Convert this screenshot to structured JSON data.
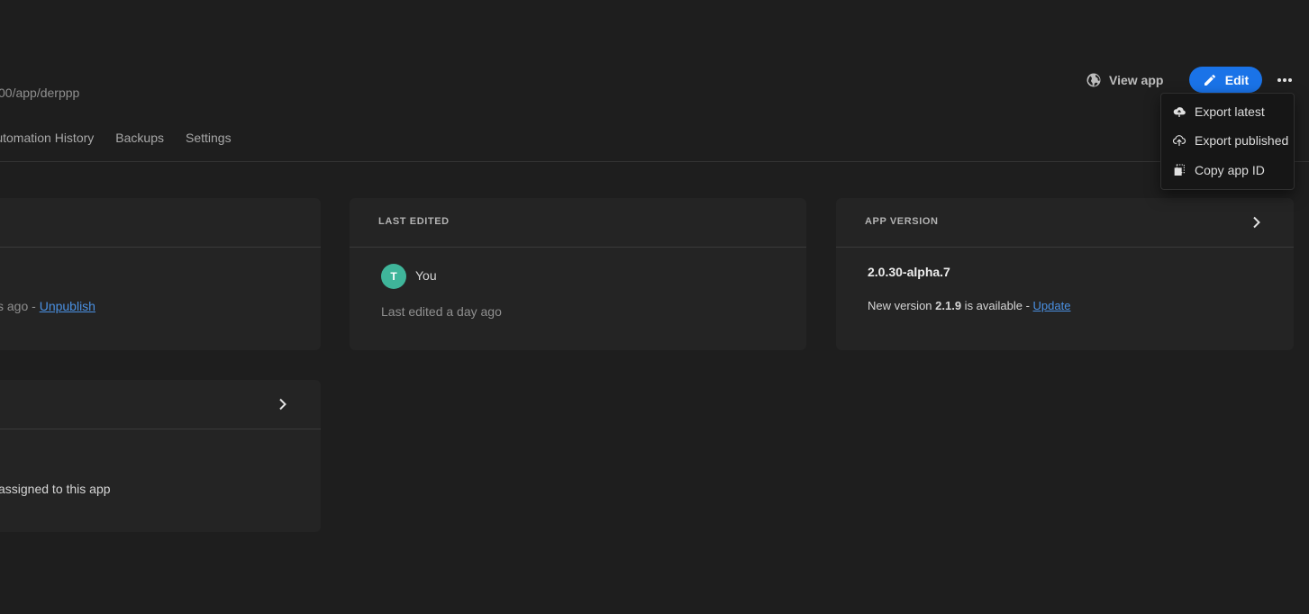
{
  "header": {
    "url_path": "00/app/derppp",
    "view_app_label": "View app",
    "edit_label": "Edit"
  },
  "tabs": [
    {
      "label": "Automation History"
    },
    {
      "label": "Backups"
    },
    {
      "label": "Settings"
    }
  ],
  "menu": {
    "items": [
      {
        "label": "Export latest",
        "icon": "cloud-upload-filled-icon"
      },
      {
        "label": "Export published",
        "icon": "cloud-upload-outline-icon"
      },
      {
        "label": "Copy app ID",
        "icon": "copy-icon"
      }
    ]
  },
  "cards": {
    "status": {
      "published_prefix": "ys ago - ",
      "unpublish_label": "Unpublish"
    },
    "users": {
      "text": "assigned to this app"
    },
    "last_edited": {
      "title": "LAST EDITED",
      "avatar_initial": "T",
      "user": "You",
      "time_text": "Last edited a day ago"
    },
    "app_version": {
      "title": "APP VERSION",
      "version": "2.0.30-alpha.7",
      "prefix": "New version ",
      "new_version": "2.1.9",
      "suffix": " is available - ",
      "update_label": "Update"
    }
  },
  "colors": {
    "background": "#1e1e1e",
    "card": "#242424",
    "accent": "#1a73e8",
    "link": "#4a90e2",
    "avatar": "#3fb59a"
  }
}
